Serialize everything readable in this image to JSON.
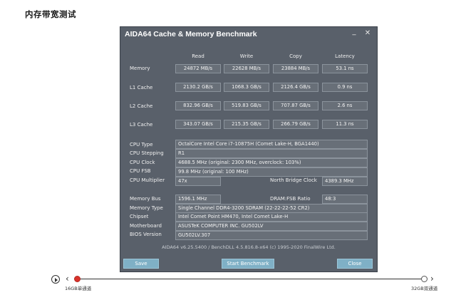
{
  "page": {
    "title": "内存带宽测试"
  },
  "window": {
    "title": "AIDA64 Cache & Memory Benchmark",
    "minimize_glyph": "_",
    "close_glyph": "✕"
  },
  "bench": {
    "headers": {
      "read": "Read",
      "write": "Write",
      "copy": "Copy",
      "latency": "Latency"
    },
    "rows": [
      {
        "label": "Memory",
        "read": "24872 MB/s",
        "write": "22628 MB/s",
        "copy": "23884 MB/s",
        "latency": "53.1 ns"
      },
      {
        "label": "L1 Cache",
        "read": "2130.2 GB/s",
        "write": "1068.3 GB/s",
        "copy": "2126.4 GB/s",
        "latency": "0.9 ns"
      },
      {
        "label": "L2 Cache",
        "read": "832.96 GB/s",
        "write": "519.83 GB/s",
        "copy": "707.87 GB/s",
        "latency": "2.6 ns"
      },
      {
        "label": "L3 Cache",
        "read": "343.07 GB/s",
        "write": "215.35 GB/s",
        "copy": "266.79 GB/s",
        "latency": "11.3 ns"
      }
    ]
  },
  "cpu": {
    "type_label": "CPU Type",
    "type_value": "OctalCore Intel Core i7-10875H  (Comet Lake-H, BGA1440)",
    "stepping_label": "CPU Stepping",
    "stepping_value": "R1",
    "clock_label": "CPU Clock",
    "clock_value": "4688.5 MHz  (original: 2300 MHz, overclock: 103%)",
    "fsb_label": "CPU FSB",
    "fsb_value": "99.8 MHz  (original: 100 MHz)",
    "multiplier_label": "CPU Multiplier",
    "multiplier_value": "47x",
    "nb_clock_label": "North Bridge Clock",
    "nb_clock_value": "4389.3 MHz"
  },
  "memory": {
    "bus_label": "Memory Bus",
    "bus_value": "1596.1 MHz",
    "ratio_label": "DRAM:FSB Ratio",
    "ratio_value": "48:3",
    "type_label": "Memory Type",
    "type_value": "Single Channel DDR4-3200 SDRAM  (22-22-22-52 CR2)",
    "chipset_label": "Chipset",
    "chipset_value": "Intel Comet Point HM470, Intel Comet Lake-H",
    "motherboard_label": "Motherboard",
    "motherboard_value": "ASUSTeK COMPUTER INC. GU502LV",
    "bios_label": "BIOS Version",
    "bios_value": "GU502LV.307"
  },
  "footer": {
    "text": "AIDA64 v6.25.5400 / BenchDLL 4.5.816.8-x64  (c) 1995-2020 FinalWire Ltd."
  },
  "buttons": {
    "save": "Save",
    "start": "Start Benchmark",
    "close": "Close"
  },
  "slider": {
    "left_label": "16GB单通道",
    "right_label": "32GB双通道",
    "position": 0
  }
}
